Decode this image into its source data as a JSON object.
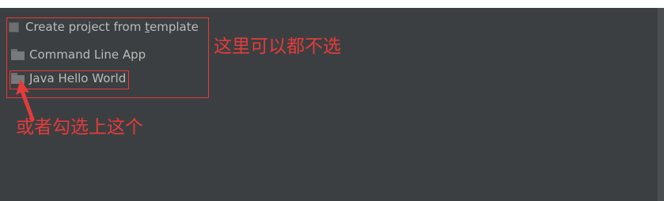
{
  "dialog": {
    "template_checkbox_label_before": "Create project from ",
    "template_checkbox_label_mnemonic": "t",
    "template_checkbox_label_after": "emplate",
    "template_checked": false,
    "templates": [
      {
        "label": "Command Line App",
        "icon": "folder-icon"
      },
      {
        "label": "Java Hello World",
        "icon": "folder-icon"
      }
    ]
  },
  "annotations": {
    "note_1": "这里可以都不选",
    "note_2": "或者勾选上这个",
    "color": "#e43b3b"
  },
  "colors": {
    "background": "#3c3f41",
    "text": "#bbbbbb"
  }
}
